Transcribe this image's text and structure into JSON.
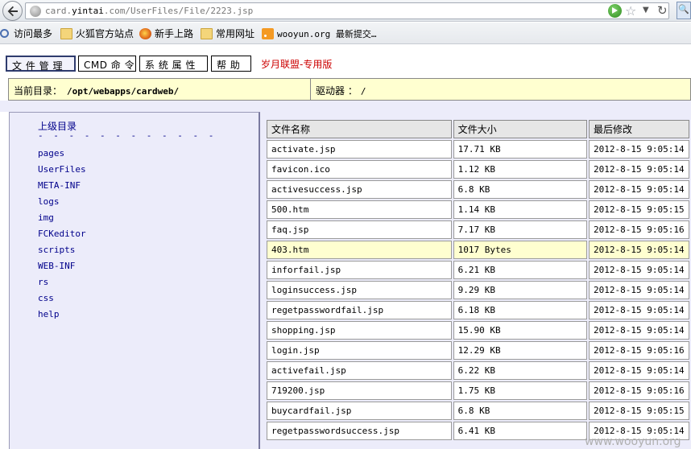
{
  "browser": {
    "url_prefix": "card.",
    "url_domain": "yintai",
    "url_suffix": ".com/UserFiles/File/2223.jsp",
    "bookmarks": [
      {
        "label": "访问最多",
        "icon": "search-icon"
      },
      {
        "label": "火狐官方站点",
        "icon": "folder-icon"
      },
      {
        "label": "新手上路",
        "icon": "firefox-icon"
      },
      {
        "label": "常用网址",
        "icon": "folder-icon"
      },
      {
        "label": "wooyun.org 最新提交…",
        "icon": "rss-icon"
      }
    ]
  },
  "tabs": [
    {
      "label": "文 件 管 理",
      "active": true
    },
    {
      "label": "CMD 命 令",
      "active": false
    },
    {
      "label": "系 统 属 性",
      "active": false
    },
    {
      "label": "帮 助",
      "active": false
    }
  ],
  "brand": "岁月联盟-专用版",
  "path": {
    "label": "当前目录：",
    "value": "/opt/webapps/cardweb/",
    "drive_label": "驱动器 ：",
    "drive_value": "/"
  },
  "sidebar": {
    "up_label": "上级目录",
    "separator": "- - - - - - - - - - - -",
    "dirs": [
      "pages",
      "UserFiles",
      "META-INF",
      "logs",
      "img",
      "FCKeditor",
      "scripts",
      "WEB-INF",
      "rs",
      "css",
      "help"
    ]
  },
  "table": {
    "headers": [
      "文件名称",
      "文件大小",
      "最后修改"
    ],
    "rows": [
      {
        "name": "activate.jsp",
        "size": "17.71 KB",
        "modified": "2012-8-15 9:05:14"
      },
      {
        "name": "favicon.ico",
        "size": "1.12 KB",
        "modified": "2012-8-15 9:05:14"
      },
      {
        "name": "activesuccess.jsp",
        "size": "6.8 KB",
        "modified": "2012-8-15 9:05:14"
      },
      {
        "name": "500.htm",
        "size": "1.14 KB",
        "modified": "2012-8-15 9:05:15"
      },
      {
        "name": "faq.jsp",
        "size": "7.17 KB",
        "modified": "2012-8-15 9:05:16"
      },
      {
        "name": "403.htm",
        "size": "1017 Bytes",
        "modified": "2012-8-15 9:05:14",
        "highlight": true
      },
      {
        "name": "inforfail.jsp",
        "size": "6.21 KB",
        "modified": "2012-8-15 9:05:14"
      },
      {
        "name": "loginsuccess.jsp",
        "size": "9.29 KB",
        "modified": "2012-8-15 9:05:14"
      },
      {
        "name": "regetpasswordfail.jsp",
        "size": "6.18 KB",
        "modified": "2012-8-15 9:05:14"
      },
      {
        "name": "shopping.jsp",
        "size": "15.90 KB",
        "modified": "2012-8-15 9:05:14"
      },
      {
        "name": "login.jsp",
        "size": "12.29 KB",
        "modified": "2012-8-15 9:05:16"
      },
      {
        "name": "activefail.jsp",
        "size": "6.22 KB",
        "modified": "2012-8-15 9:05:14"
      },
      {
        "name": "719200.jsp",
        "size": "1.75 KB",
        "modified": "2012-8-15 9:05:16"
      },
      {
        "name": "buycardfail.jsp",
        "size": "6.8 KB",
        "modified": "2012-8-15 9:05:15"
      },
      {
        "name": "regetpasswordsuccess.jsp",
        "size": "6.41 KB",
        "modified": "2012-8-15 9:05:14"
      }
    ]
  },
  "watermark": "www.wooyun.org"
}
